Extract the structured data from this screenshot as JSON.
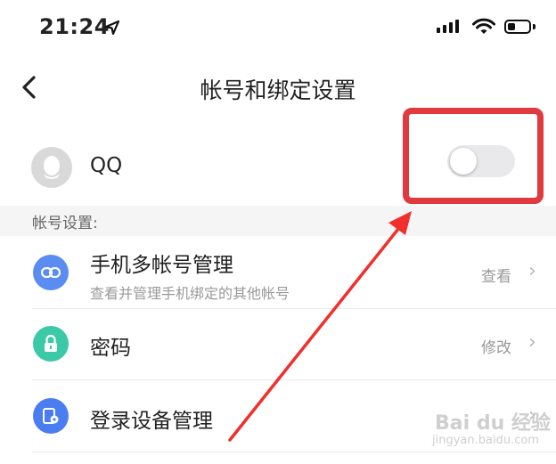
{
  "status_bar": {
    "time": "21:24"
  },
  "header": {
    "title": "帐号和绑定设置"
  },
  "qq_row": {
    "label": "QQ",
    "toggle_on": false
  },
  "section": {
    "label": "帐号设置:"
  },
  "rows": [
    {
      "title": "手机多帐号管理",
      "subtitle": "查看并管理手机绑定的其他帐号",
      "action": "查看",
      "icon": "link-icon",
      "color": "#5b8cf2"
    },
    {
      "title": "密码",
      "action": "修改",
      "icon": "lock-icon",
      "color": "#3cc9a7"
    },
    {
      "title": "登录设备管理",
      "action": "",
      "icon": "device-settings-icon",
      "color": "#4a7df0"
    }
  ],
  "watermark": {
    "brand": "Bai du 经验",
    "url": "jingyan.baidu.com"
  },
  "colors": {
    "highlight": "#e0393e",
    "arrow": "#f0302c"
  }
}
